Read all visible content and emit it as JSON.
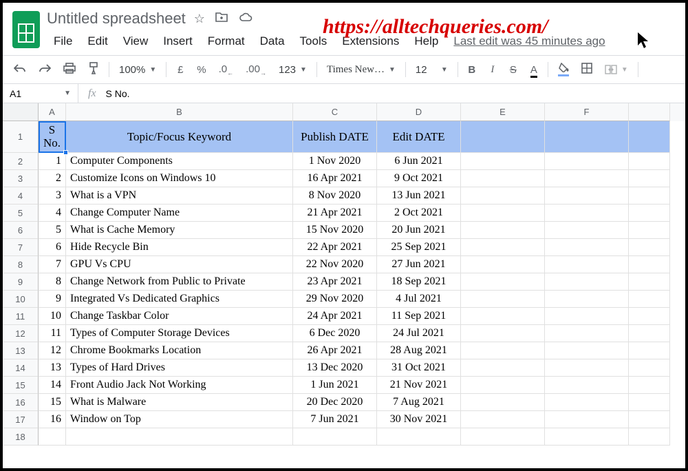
{
  "watermark_url": "https://alltechqueries.com/",
  "header": {
    "doc_title": "Untitled spreadsheet",
    "last_edit": "Last edit was 45 minutes ago"
  },
  "menu": {
    "file": "File",
    "edit": "Edit",
    "view": "View",
    "insert": "Insert",
    "format": "Format",
    "data": "Data",
    "tools": "Tools",
    "extensions": "Extensions",
    "help": "Help"
  },
  "toolbar": {
    "zoom": "100%",
    "currency": "£",
    "percent": "%",
    "dec_minus": ".0",
    "dec_plus": ".00",
    "more_fmt": "123",
    "font": "Times New…",
    "size": "12",
    "bold": "B",
    "italic": "I",
    "strike": "S",
    "text_color": "A"
  },
  "namebox": {
    "ref": "A1",
    "fx": "fx",
    "content": "S No."
  },
  "columns": [
    "A",
    "B",
    "C",
    "D",
    "E",
    "F"
  ],
  "header_cells": {
    "A": "S No.",
    "B": "Topic/Focus Keyword",
    "C": "Publish DATE",
    "D": "Edit DATE"
  },
  "rows": [
    {
      "n": "1",
      "topic": "Computer Components",
      "pub": "1 Nov 2020",
      "edit": "6 Jun 2021"
    },
    {
      "n": "2",
      "topic": "Customize Icons on Windows 10",
      "pub": "16 Apr 2021",
      "edit": "9 Oct 2021"
    },
    {
      "n": "3",
      "topic": "What is a VPN",
      "pub": "8 Nov 2020",
      "edit": "13 Jun 2021"
    },
    {
      "n": "4",
      "topic": "Change Computer Name",
      "pub": "21 Apr 2021",
      "edit": "2 Oct 2021"
    },
    {
      "n": "5",
      "topic": "What is Cache Memory",
      "pub": "15 Nov 2020",
      "edit": "20 Jun 2021"
    },
    {
      "n": "6",
      "topic": "Hide Recycle Bin",
      "pub": "22 Apr 2021",
      "edit": "25 Sep 2021"
    },
    {
      "n": "7",
      "topic": "GPU Vs CPU",
      "pub": "22 Nov 2020",
      "edit": "27 Jun 2021"
    },
    {
      "n": "8",
      "topic": "Change Network from Public to Private",
      "pub": "23 Apr 2021",
      "edit": "18 Sep 2021"
    },
    {
      "n": "9",
      "topic": "Integrated Vs Dedicated Graphics",
      "pub": "29 Nov 2020",
      "edit": "4 Jul 2021"
    },
    {
      "n": "10",
      "topic": "Change Taskbar Color",
      "pub": "24 Apr 2021",
      "edit": "11 Sep 2021"
    },
    {
      "n": "11",
      "topic": "Types of Computer Storage Devices",
      "pub": "6 Dec 2020",
      "edit": "24 Jul 2021"
    },
    {
      "n": "12",
      "topic": "Chrome Bookmarks Location",
      "pub": "26 Apr 2021",
      "edit": "28 Aug 2021"
    },
    {
      "n": "13",
      "topic": "Types of Hard Drives",
      "pub": "13 Dec 2020",
      "edit": "31 Oct 2021"
    },
    {
      "n": "14",
      "topic": "Front Audio Jack Not Working",
      "pub": "1 Jun 2021",
      "edit": "21 Nov 2021"
    },
    {
      "n": "15",
      "topic": "What is Malware",
      "pub": "20 Dec 2020",
      "edit": "7 Aug 2021"
    },
    {
      "n": "16",
      "topic": "Window on Top",
      "pub": "7 Jun 2021",
      "edit": "30 Nov 2021"
    }
  ]
}
